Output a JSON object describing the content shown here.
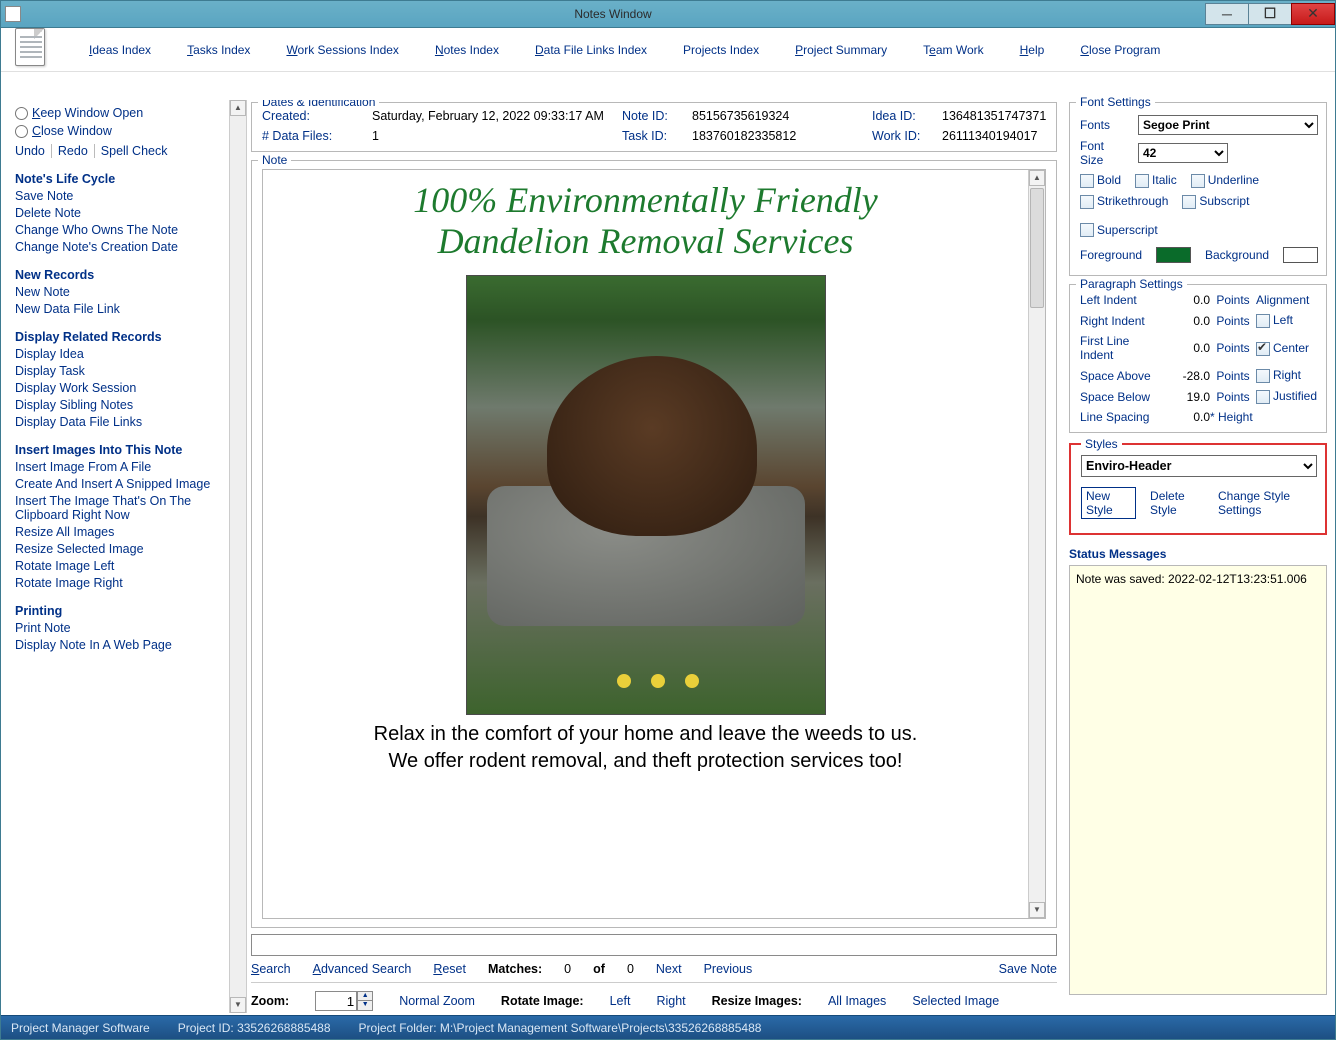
{
  "window": {
    "title": "Notes Window"
  },
  "menu": {
    "ideas": "Ideas Index",
    "tasks": "Tasks Index",
    "work": "Work Sessions Index",
    "notes": "Notes Index",
    "datafile": "Data File Links Index",
    "projects": "Projects Index",
    "summary": "Project Summary",
    "team": "Team Work",
    "help": "Help",
    "close": "Close Program"
  },
  "left": {
    "keep_open": "Keep Window Open",
    "close_window": "Close Window",
    "undo": "Undo",
    "redo": "Redo",
    "spellcheck": "Spell Check",
    "lifecycle_title": "Note's Life Cycle",
    "save_note": "Save Note",
    "delete_note": "Delete Note",
    "change_owner": "Change Who Owns The Note",
    "change_date": "Change Note's Creation Date",
    "new_records_title": "New Records",
    "new_note": "New Note",
    "new_dfl": "New Data File Link",
    "display_title": "Display Related Records",
    "display_idea": "Display Idea",
    "display_task": "Display Task",
    "display_ws": "Display Work Session",
    "display_sibling": "Display Sibling Notes",
    "display_dfl": "Display Data File Links",
    "insert_title": "Insert Images Into This Note",
    "insert_file": "Insert Image From A File",
    "create_snip": "Create And Insert A Snipped Image",
    "insert_clip": "Insert The Image That's On The Clipboard Right Now",
    "resize_all": "Resize All Images",
    "resize_sel": "Resize Selected Image",
    "rotate_left": "Rotate Image Left",
    "rotate_right": "Rotate Image Right",
    "printing_title": "Printing",
    "print_note": "Print Note",
    "display_web": "Display Note In A Web Page"
  },
  "dates": {
    "legend": "Dates & Identification",
    "created_lbl": "Created:",
    "created_val": "Saturday, February 12, 2022   09:33:17 AM",
    "data_files_lbl": "# Data Files:",
    "data_files_val": "1",
    "note_id_lbl": "Note ID:",
    "note_id_val": "85156735619324",
    "task_id_lbl": "Task ID:",
    "task_id_val": "183760182335812",
    "idea_id_lbl": "Idea ID:",
    "idea_id_val": "136481351747371",
    "work_id_lbl": "Work ID:",
    "work_id_val": "26111340194017"
  },
  "note": {
    "legend": "Note",
    "header1": "100% Environmentally Friendly",
    "header2": "Dandelion Removal Services",
    "caption1": "Relax in the comfort of your home and leave the weeds to us.",
    "caption2": "We offer rodent removal, and theft protection services too!"
  },
  "search": {
    "placeholder": "",
    "search": "Search",
    "advanced": "Advanced Search",
    "reset": "Reset",
    "matches_lbl": "Matches:",
    "matches_val": "0",
    "of": "of",
    "of_val": "0",
    "next": "Next",
    "previous": "Previous",
    "save_note": "Save Note"
  },
  "zoom": {
    "label": "Zoom:",
    "value": "1",
    "normal": "Normal Zoom",
    "rotate_lbl": "Rotate Image:",
    "rotate_left": "Left",
    "rotate_right": "Right",
    "resize_lbl": "Resize Images:",
    "all": "All Images",
    "selected": "Selected Image"
  },
  "font": {
    "legend": "Font Settings",
    "fonts_lbl": "Fonts",
    "fonts_val": "Segoe Print",
    "fontsize_lbl": "Font Size",
    "fontsize_val": "42",
    "bold": "Bold",
    "italic": "Italic",
    "underline": "Underline",
    "strike": "Strikethrough",
    "subscript": "Subscript",
    "superscript": "Superscript",
    "foreground": "Foreground",
    "background": "Background"
  },
  "para": {
    "legend": "Paragraph Settings",
    "left_indent": "Left Indent",
    "left_indent_v": "0.0",
    "right_indent": "Right Indent",
    "right_indent_v": "0.0",
    "first_line": "First Line Indent",
    "first_line_v": "0.0",
    "space_above": "Space Above",
    "space_above_v": "-28.0",
    "space_below": "Space Below",
    "space_below_v": "19.0",
    "line_spacing": "Line Spacing",
    "line_spacing_v": "0.0",
    "points": "Points",
    "height": "* Height",
    "alignment": "Alignment",
    "left": "Left",
    "center": "Center",
    "right": "Right",
    "justified": "Justified"
  },
  "styles": {
    "legend": "Styles",
    "value": "Enviro-Header",
    "new_style": "New Style",
    "delete_style": "Delete Style",
    "change": "Change Style Settings"
  },
  "status": {
    "legend": "Status Messages",
    "msg": "Note was saved:  2022-02-12T13:23:51.006"
  },
  "statusbar": {
    "app": "Project Manager Software",
    "project_id": "Project ID:  33526268885488",
    "project_folder": "Project Folder:  M:\\Project Management Software\\Projects\\33526268885488"
  }
}
